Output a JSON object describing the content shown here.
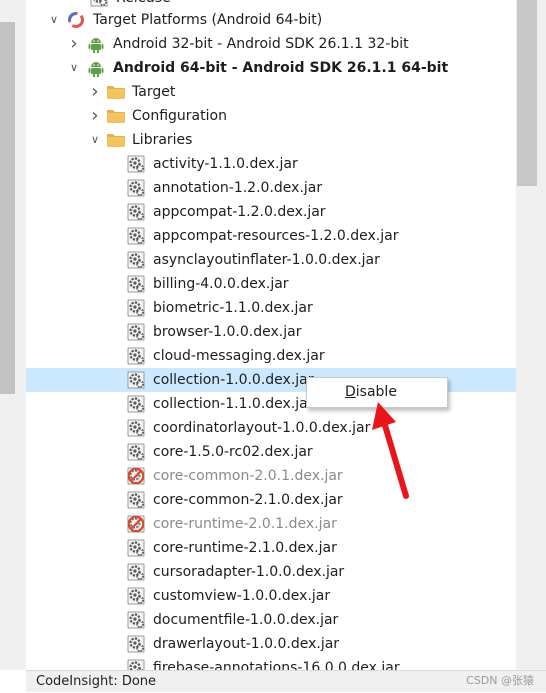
{
  "tree": {
    "rows": [
      {
        "label": "Release",
        "icon": "gear-icon",
        "arrow": ""
      },
      {
        "label": "Target Platforms (Android 64-bit)",
        "icon": "ring-icon",
        "arrow": "expanded"
      },
      {
        "label": "Android 32-bit - Android SDK 26.1.1 32-bit",
        "icon": "android-icon",
        "arrow": "collapsed"
      },
      {
        "label": "Android 64-bit - Android SDK 26.1.1 64-bit",
        "icon": "android-icon",
        "arrow": "expanded"
      },
      {
        "label": "Target",
        "icon": "folder-icon",
        "arrow": "collapsed"
      },
      {
        "label": "Configuration",
        "icon": "folder-icon",
        "arrow": "collapsed"
      },
      {
        "label": "Libraries",
        "icon": "folder-icon",
        "arrow": "expanded"
      },
      {
        "label": "activity-1.1.0.dex.jar",
        "icon": "gear-icon"
      },
      {
        "label": "annotation-1.2.0.dex.jar",
        "icon": "gear-icon"
      },
      {
        "label": "appcompat-1.2.0.dex.jar",
        "icon": "gear-icon"
      },
      {
        "label": "appcompat-resources-1.2.0.dex.jar",
        "icon": "gear-icon"
      },
      {
        "label": "asynclayoutinflater-1.0.0.dex.jar",
        "icon": "gear-icon"
      },
      {
        "label": "billing-4.0.0.dex.jar",
        "icon": "gear-icon"
      },
      {
        "label": "biometric-1.1.0.dex.jar",
        "icon": "gear-icon"
      },
      {
        "label": "browser-1.0.0.dex.jar",
        "icon": "gear-icon"
      },
      {
        "label": "cloud-messaging.dex.jar",
        "icon": "gear-icon"
      },
      {
        "label": "collection-1.0.0.dex.jar",
        "icon": "gear-icon",
        "selected": true
      },
      {
        "label": "collection-1.1.0.dex.jar",
        "icon": "gear-icon"
      },
      {
        "label": "coordinatorlayout-1.0.0.dex.jar",
        "icon": "gear-icon"
      },
      {
        "label": "core-1.5.0-rc02.dex.jar",
        "icon": "gear-icon"
      },
      {
        "label": "core-common-2.0.1.dex.jar",
        "icon": "disabled-gear-icon",
        "disabled": true
      },
      {
        "label": "core-common-2.1.0.dex.jar",
        "icon": "gear-icon"
      },
      {
        "label": "core-runtime-2.0.1.dex.jar",
        "icon": "disabled-gear-icon",
        "disabled": true
      },
      {
        "label": "core-runtime-2.1.0.dex.jar",
        "icon": "gear-icon"
      },
      {
        "label": "cursoradapter-1.0.0.dex.jar",
        "icon": "gear-icon"
      },
      {
        "label": "customview-1.0.0.dex.jar",
        "icon": "gear-icon"
      },
      {
        "label": "documentfile-1.0.0.dex.jar",
        "icon": "gear-icon"
      },
      {
        "label": "drawerlayout-1.0.0.dex.jar",
        "icon": "gear-icon"
      },
      {
        "label": "firebase-annotations-16.0.0.dex.jar",
        "icon": "gear-icon"
      }
    ]
  },
  "context_menu": {
    "item_rest": "isable",
    "item_mnemonic": "D"
  },
  "status_bar": {
    "text": "CodeInsight: Done"
  },
  "watermark": {
    "text": "CSDN @张猿"
  },
  "colors": {
    "selection": "#cce8ff",
    "arrow": "#e8161b",
    "android": "#5fa244",
    "folder": "#e8b048",
    "disabled_icon": "#d9482b"
  }
}
